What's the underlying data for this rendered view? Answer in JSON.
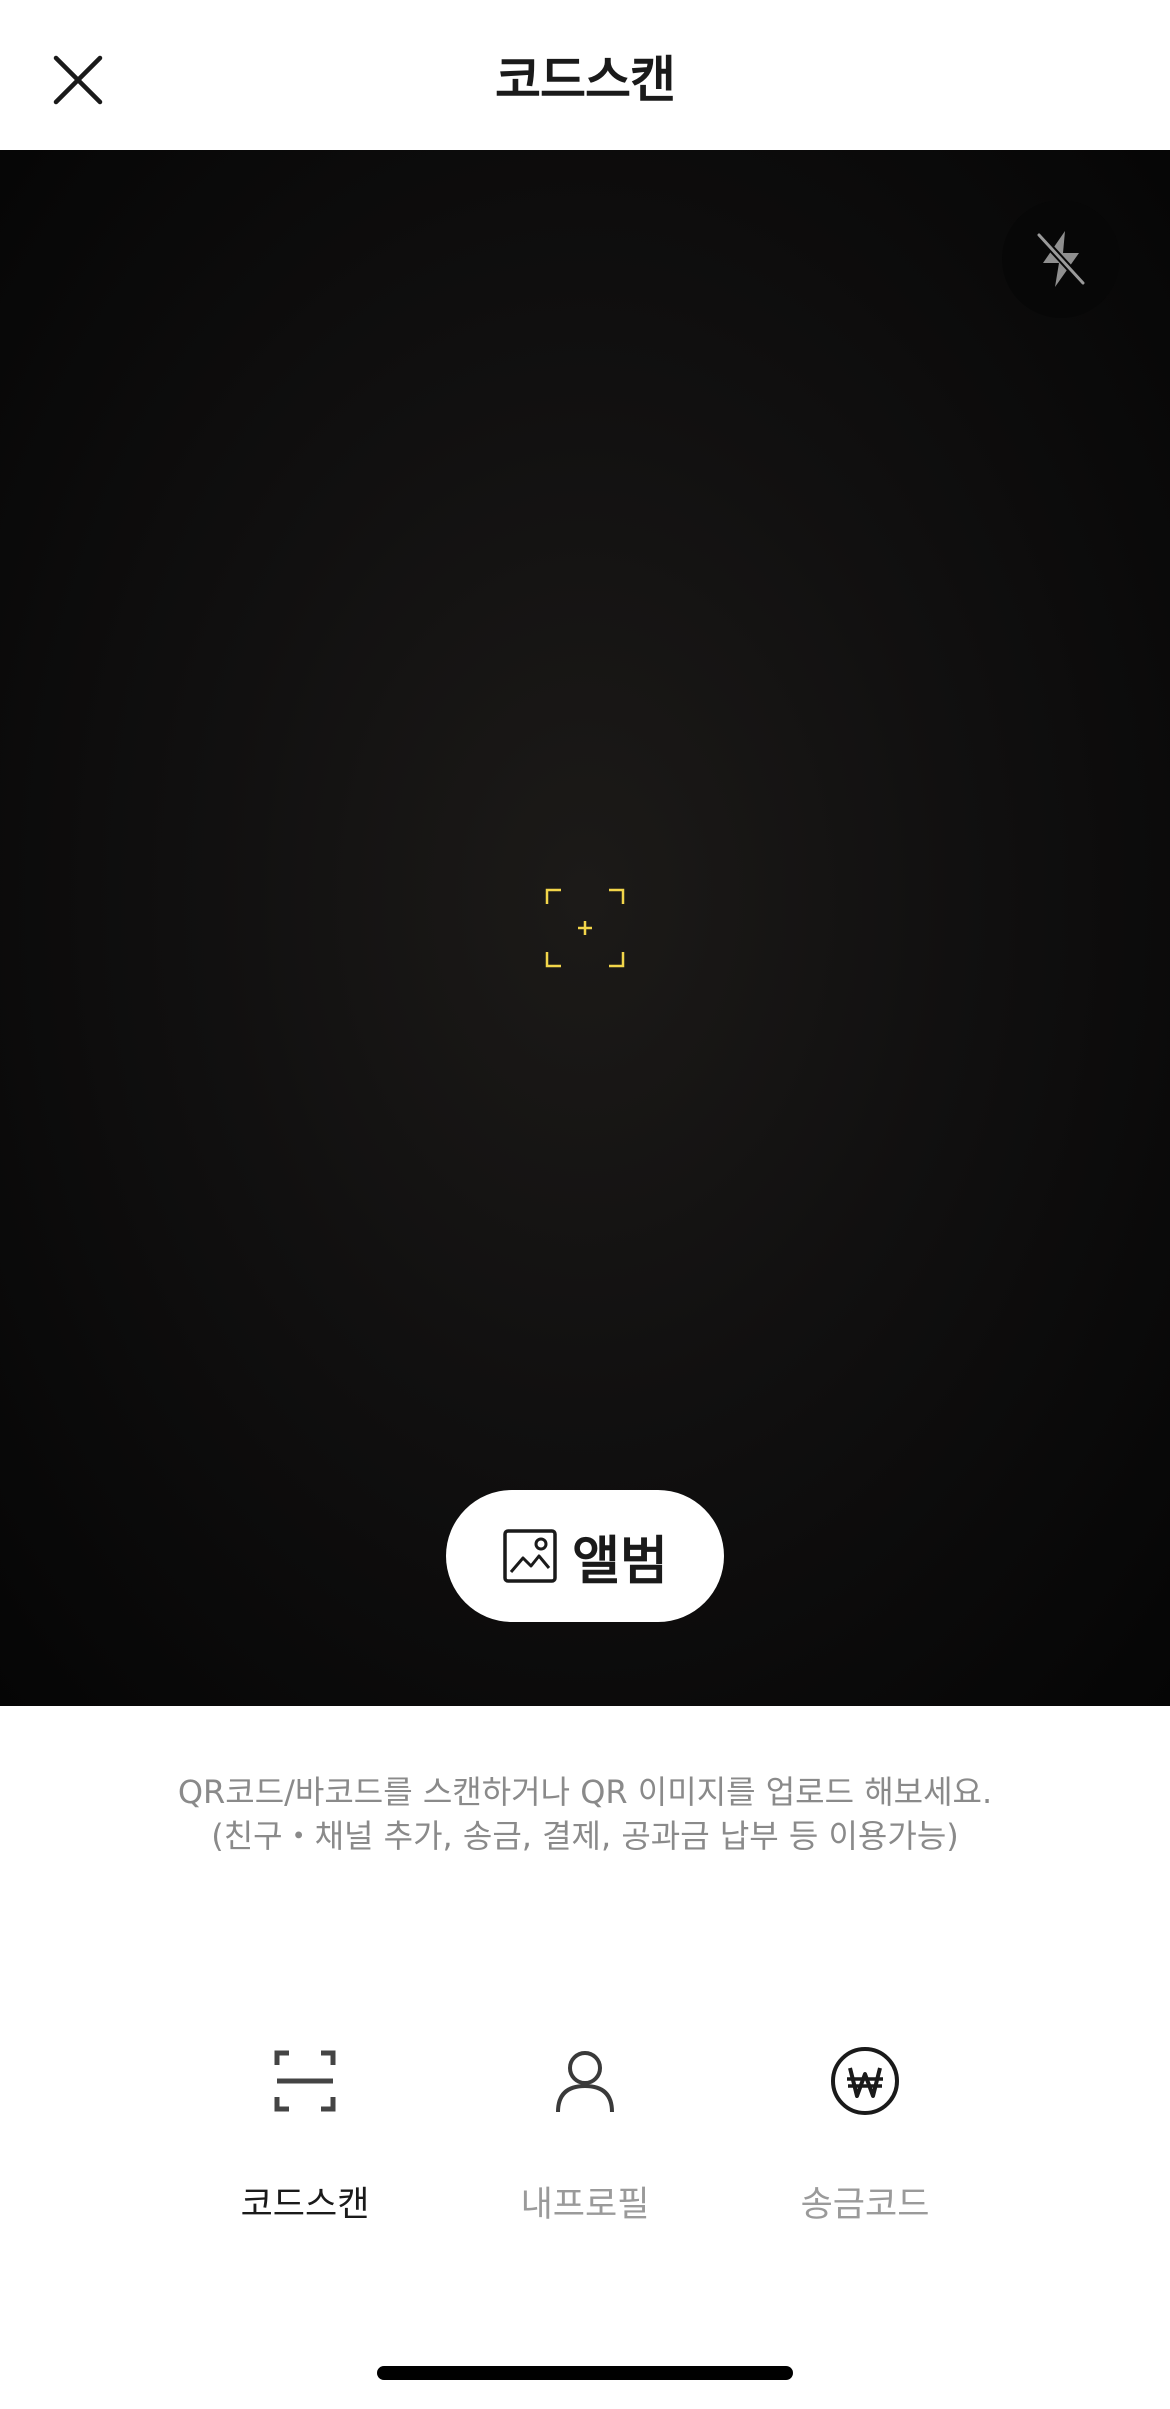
{
  "header": {
    "title": "코드스캔",
    "close_icon": "close-icon"
  },
  "camera": {
    "flash_icon": "flash-off-icon",
    "focus_icon": "focus-reticle-icon",
    "focus_color": "#f2d54a"
  },
  "album_button": {
    "label": "앨범",
    "icon": "photo-album-icon"
  },
  "description": {
    "line1": "QR코드/바코드를 스캔하거나 QR 이미지를 업로드 해보세요.",
    "line2": "(친구・채널 추가, 송금, 결제, 공과금 납부 등 이용가능)"
  },
  "tabs": [
    {
      "label": "코드스캔",
      "icon": "code-scan-icon",
      "active": true
    },
    {
      "label": "내프로필",
      "icon": "profile-icon",
      "active": false
    },
    {
      "label": "송금코드",
      "icon": "won-code-icon",
      "active": false
    }
  ]
}
